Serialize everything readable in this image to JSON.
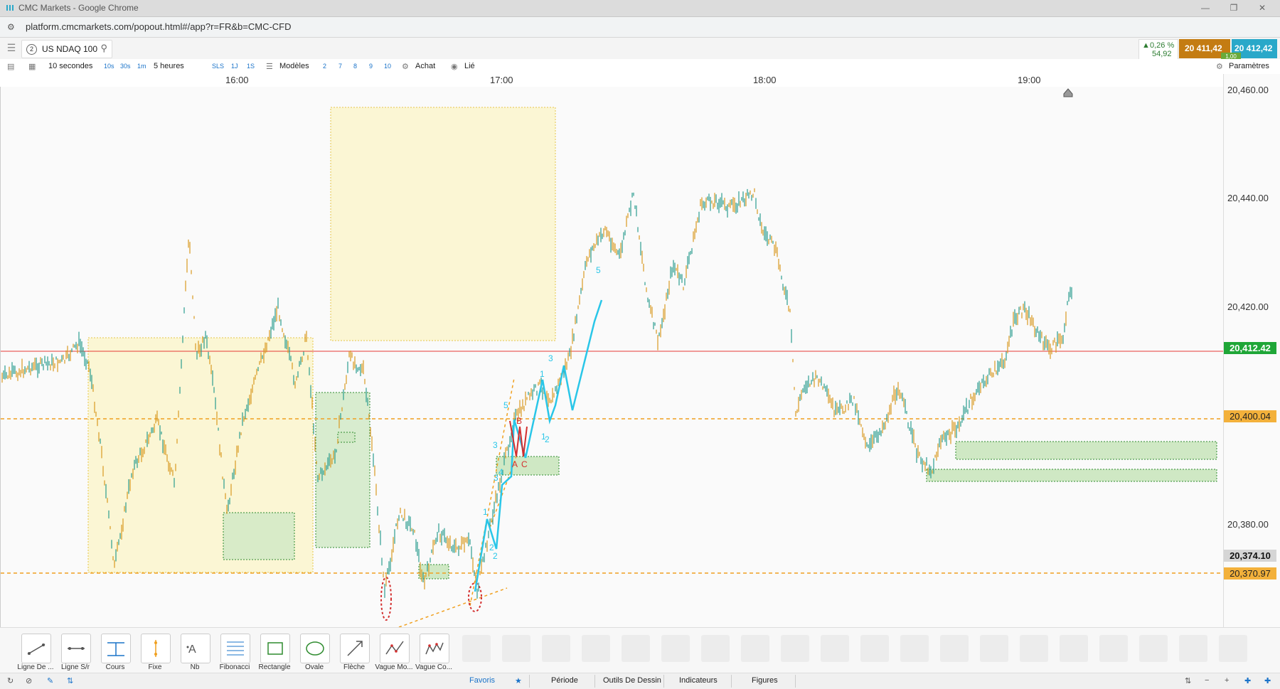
{
  "window": {
    "title": "CMC Markets - Google Chrome",
    "url": "platform.cmcmarkets.com/popout.html#/app?r=FR&b=CMC-CFD"
  },
  "instrument": {
    "tab_number": "2",
    "name": "US NDAQ 100",
    "change_pct": "0,26 %",
    "change_pts": "54,92",
    "sell_price": "20 411,42",
    "buy_price": "20 412,42",
    "spread": "1,00"
  },
  "toolbar": {
    "interval": "10 secondes",
    "interval_buttons": [
      "10s",
      "30s",
      "1m"
    ],
    "range": "5 heures",
    "range_buttons": [
      "SLS",
      "1J",
      "1S"
    ],
    "templates": "Modèles",
    "layout_buttons": [
      "2",
      "7",
      "8",
      "9",
      "10"
    ],
    "buy": "Achat",
    "linked": "Lié",
    "settings": "Paramètres"
  },
  "time_axis": [
    "16:00",
    "17:00",
    "18:00",
    "19:00"
  ],
  "price_axis": [
    "20,460.00",
    "20,440.00",
    "20,420.00",
    "20,380.00"
  ],
  "price_tags": {
    "current": "20,412.42",
    "level_upper": "20,400.04",
    "crosshair": "20,374.10",
    "level_lower": "20,370.97"
  },
  "wave_labels": {
    "cyan": [
      "1",
      "2",
      "3",
      "4",
      "5",
      "1",
      "2",
      "3",
      "3",
      "2",
      "1",
      "5"
    ],
    "red": [
      "B",
      "A",
      "C"
    ]
  },
  "colors": {
    "sell": "#c47c12",
    "buy": "#29a8c9",
    "current_line": "#e53935",
    "level_line": "#f0a020",
    "candle_up": "#2a9d8f",
    "candle_down": "#d99a20"
  },
  "tools": [
    {
      "label": "Ligne De ...",
      "icon": "trend-line-icon"
    },
    {
      "label": "Ligne S/r",
      "icon": "horizontal-line-icon"
    },
    {
      "label": "Cours",
      "icon": "price-line-icon"
    },
    {
      "label": "Fixe",
      "icon": "vertical-line-icon"
    },
    {
      "label": "Nb",
      "icon": "text-note-icon"
    },
    {
      "label": "Fibonacci",
      "icon": "fibonacci-icon"
    },
    {
      "label": "Rectangle",
      "icon": "rectangle-icon"
    },
    {
      "label": "Ovale",
      "icon": "ellipse-icon"
    },
    {
      "label": "Flèche",
      "icon": "arrow-icon"
    },
    {
      "label": "Vague Mo...",
      "icon": "wave-icon"
    },
    {
      "label": "Vague Co...",
      "icon": "wave-correction-icon"
    }
  ],
  "bottom_tabs": [
    "Favoris",
    "Période",
    "Outils De Dessin",
    "Indicateurs",
    "Figures"
  ]
}
